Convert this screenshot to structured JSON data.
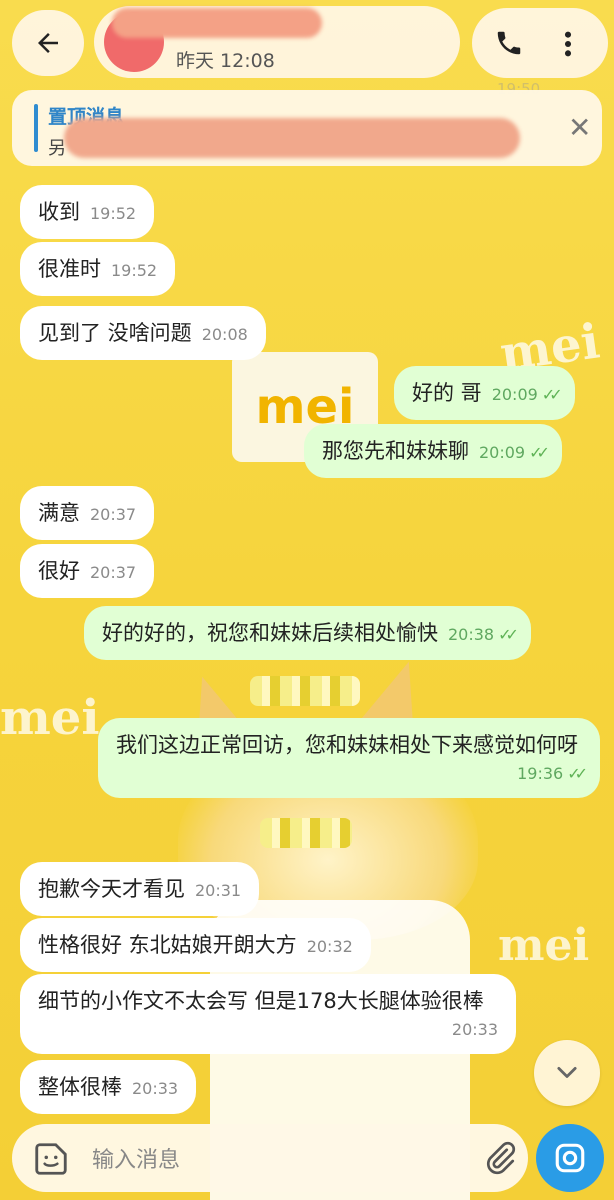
{
  "header": {
    "last_seen": "昨天 12:08"
  },
  "faint_time": "19:50",
  "pinned": {
    "label": "置顶消息",
    "first_char": "另"
  },
  "messages": [
    {
      "dir": "in",
      "text": "收到",
      "time": "19:52"
    },
    {
      "dir": "in",
      "text": "很准时",
      "time": "19:52"
    },
    {
      "dir": "in",
      "text": "见到了 没啥问题",
      "time": "20:08"
    },
    {
      "dir": "out",
      "text": "好的 哥",
      "time": "20:09"
    },
    {
      "dir": "out",
      "text": "那您先和妹妹聊",
      "time": "20:09"
    },
    {
      "dir": "in",
      "text": "满意",
      "time": "20:37"
    },
    {
      "dir": "in",
      "text": "很好",
      "time": "20:37"
    },
    {
      "dir": "out",
      "text": "好的好的，祝您和妹妹后续相处愉快",
      "time": "20:38"
    },
    {
      "dir": "out",
      "text": "我们这边正常回访，您和妹妹相处下来感觉如何呀",
      "time": "19:36"
    },
    {
      "dir": "in",
      "text": "抱歉今天才看见",
      "time": "20:31"
    },
    {
      "dir": "in",
      "text": "性格很好 东北姑娘开朗大方",
      "time": "20:32"
    },
    {
      "dir": "in",
      "text": "细节的小作文不太会写 但是178大长腿体验很棒",
      "time": "20:33"
    },
    {
      "dir": "in",
      "text": "整体很棒",
      "time": "20:33"
    }
  ],
  "background": {
    "logo_text": "mei",
    "watermark": "mei"
  },
  "input": {
    "placeholder": "输入消息"
  },
  "colors": {
    "background": "#f7d640",
    "bubble_in": "#ffffff",
    "bubble_out": "#e1ffd4",
    "accent": "#2a9ce6",
    "check": "#5fb356"
  },
  "icons": [
    "back-arrow-icon",
    "phone-icon",
    "more-vert-icon",
    "close-icon",
    "chevron-down-icon",
    "sticker-icon",
    "attach-icon",
    "camera-icon"
  ]
}
